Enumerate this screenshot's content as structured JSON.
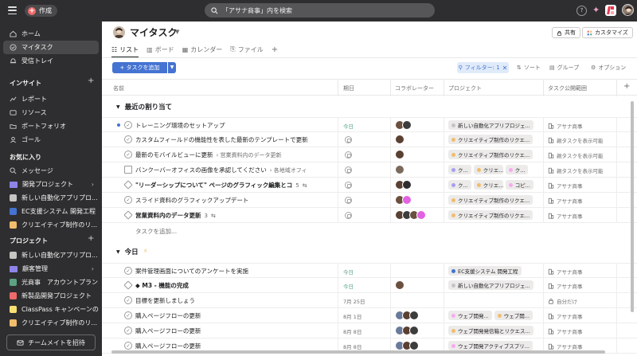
{
  "topbar": {
    "create_label": "作成",
    "search_text": "「アサナ商事」内を検索",
    "help_label": "?"
  },
  "sidebar": {
    "nav": [
      {
        "label": "ホーム",
        "icon": "home-icon"
      },
      {
        "label": "マイタスク",
        "icon": "check-circle-icon"
      },
      {
        "label": "受信トレイ",
        "icon": "bell-icon"
      }
    ],
    "insights_title": "インサイト",
    "insights": [
      {
        "label": "レポート",
        "icon": "chart-icon"
      },
      {
        "label": "リソース",
        "icon": "people-icon"
      },
      {
        "label": "ポートフォリオ",
        "icon": "folder-icon"
      },
      {
        "label": "ゴール",
        "icon": "person-icon"
      }
    ],
    "favorites_title": "お気に入り",
    "favorites": [
      {
        "label": "メッセージ",
        "type": "search",
        "color": ""
      },
      {
        "label": "開発プロジェクト",
        "type": "folder",
        "color": "#8d84e8"
      },
      {
        "label": "新しい自動化アプリプロ...",
        "type": "square",
        "color": "#c7c4c4"
      },
      {
        "label": "EC支援システム 開発工程",
        "type": "square",
        "color": "#4573d2"
      },
      {
        "label": "クリエイティブ制作のリ...",
        "type": "square",
        "color": "#f1bd6c"
      }
    ],
    "projects_title": "プロジェクト",
    "projects": [
      {
        "label": "新しい自動化アプリプロ...",
        "type": "square",
        "color": "#c7c4c4"
      },
      {
        "label": "顧客管理",
        "type": "folder",
        "color": "#8d84e8"
      },
      {
        "label": "光商事　アカウントプラン",
        "type": "square",
        "color": "#5da283"
      },
      {
        "label": "新製品開発プロジェクト",
        "type": "square",
        "color": "#f06a6a"
      },
      {
        "label": "ClassPass キャンペーンの...",
        "type": "square",
        "color": "#f8df72"
      },
      {
        "label": "クリエイティブ制作のリ...",
        "type": "square",
        "color": "#f1bd6c"
      }
    ],
    "invite_label": "チームメイトを招待"
  },
  "header": {
    "title": "マイタスク",
    "share_label": "共有",
    "customize_label": "カスタマイズ",
    "tabs": [
      {
        "label": "リスト",
        "icon": "list-icon"
      },
      {
        "label": "ボード",
        "icon": "board-icon"
      },
      {
        "label": "カレンダー",
        "icon": "calendar-icon"
      },
      {
        "label": "ファイル",
        "icon": "file-icon"
      }
    ],
    "add_tab": "+"
  },
  "toolbar": {
    "add_task_label": "+ タスクを追加",
    "filter_label": "フィルター: 1",
    "sort_label": "ソート",
    "group_label": "グループ",
    "options_label": "オプション"
  },
  "columns": {
    "name": "名前",
    "due": "期日",
    "collaborators": "コラボレーター",
    "project": "プロジェクト",
    "visibility": "タスク公開範囲"
  },
  "groups": [
    {
      "title": "最近の割り当て",
      "tasks": [
        {
          "name": "トレーニング環境のセットアップ",
          "sub": "",
          "badge": "",
          "date": "今日",
          "date_green": true,
          "check": "circle",
          "dot": true,
          "avatars": [
            "#6b4f3f",
            "#3d3d3d"
          ],
          "pills": [
            {
              "label": "新しい自動化アプリプロジェ...",
              "color": "#c7c4c4"
            }
          ],
          "visibility": "アサナ商事"
        },
        {
          "name": "カスタムフィールドの機能性を表した最新のテンプレートで更新",
          "sub": "",
          "badge": "",
          "date": "",
          "date_green": false,
          "check": "circle",
          "dot": false,
          "avatars": [
            "#5a4032"
          ],
          "pills": [
            {
              "label": "クリエイティブ制作のリクエ...",
              "color": "#f1bd6c"
            }
          ],
          "visibility": "親タスクを表示可能"
        },
        {
          "name": "最新のモバイルビューに更新",
          "sub": "› 営業資料内のデータ更新",
          "badge": "",
          "date": "",
          "date_green": false,
          "check": "circle",
          "dot": false,
          "avatars": [
            "#5a4032"
          ],
          "pills": [
            {
              "label": "クリエイティブ制作のリクエ...",
              "color": "#f1bd6c"
            }
          ],
          "visibility": "親タスクを表示可能"
        },
        {
          "name": "バンクーバーオフィスの画像を承認してください",
          "sub": "› 各地域オフィ",
          "badge": "",
          "date": "",
          "date_green": false,
          "check": "approval",
          "dot": false,
          "avatars": [
            "#7a6a5e"
          ],
          "pills": [
            {
              "label": "ク...",
              "color": "#a69ff3"
            },
            {
              "label": "クリエ...",
              "color": "#f1bd6c"
            },
            {
              "label": "ク...",
              "color": "#f9aaef"
            }
          ],
          "visibility": "親タスクを表示可能"
        },
        {
          "name": "\"リーダーシップについて\" ページのグラフィック編集とコ",
          "sub": "",
          "badge": "5",
          "date": "",
          "date_green": false,
          "check": "milestone",
          "dot": false,
          "avatars": [
            "#5a4032",
            "#2e2e30"
          ],
          "pills": [
            {
              "label": "ク...",
              "color": "#a69ff3"
            },
            {
              "label": "クリエ...",
              "color": "#f1bd6c"
            },
            {
              "label": "コピ...",
              "color": "#f9aaef"
            }
          ],
          "visibility": "アサナ商事"
        },
        {
          "name": "スライド資料のグラフィックアップデート",
          "sub": "",
          "badge": "",
          "date": "",
          "date_green": false,
          "check": "circle",
          "dot": false,
          "avatars": [
            "#6b4f3f",
            "#e362e3"
          ],
          "pills": [
            {
              "label": "クリエイティブ制作のリクエ...",
              "color": "#f1bd6c"
            }
          ],
          "visibility": "アサナ商事"
        },
        {
          "name": "営業資料内のデータ更新",
          "sub": "",
          "badge": "3",
          "date": "",
          "date_green": false,
          "check": "milestone",
          "dot": false,
          "avatars": [
            "#5a4032",
            "#3d3d3d",
            "#6b4f3f",
            "#e362e3"
          ],
          "pills": [
            {
              "label": "クリエイティブ制作のリクエ...",
              "color": "#f1bd6c"
            }
          ],
          "visibility": "アサナ商事"
        }
      ],
      "add_task": "タスクを追加..."
    },
    {
      "title": "今日",
      "tasks": [
        {
          "name": "案件管理画面についてのアンケートを実施",
          "sub": "",
          "badge": "",
          "date": "今日",
          "date_green": true,
          "check": "circle",
          "dot": false,
          "avatars": [],
          "pills": [
            {
              "label": "EC支援システム 開発工程",
              "color": "#4573d2"
            }
          ],
          "visibility": "アサナ商事"
        },
        {
          "name": "◆ M3 - 機能の完成",
          "sub": "",
          "badge": "",
          "date": "今日",
          "date_green": true,
          "check": "milestone",
          "dot": false,
          "avatars": [
            "#6b4f3f"
          ],
          "pills": [
            {
              "label": "新しい自動化アプリプロジェ...",
              "color": "#c7c4c4"
            }
          ],
          "visibility": "アサナ商事"
        },
        {
          "name": "目標を更新しましょう",
          "sub": "",
          "badge": "",
          "date": "7月 25日",
          "date_green": false,
          "check": "circle",
          "dot": false,
          "avatars": [],
          "pills": [],
          "visibility": "自分だけ"
        },
        {
          "name": "購入ページフローの更新",
          "sub": "",
          "badge": "",
          "date": "8月 1日",
          "date_green": false,
          "check": "circle",
          "dot": false,
          "avatars": [
            "#6a7a9a",
            "#5a4032",
            "#3d3d3d"
          ],
          "pills": [
            {
              "label": "ウェブ開発...",
              "color": "#f9aaef"
            },
            {
              "label": "ウェブ開...",
              "color": "#f1bd6c"
            }
          ],
          "visibility": "アサナ商事"
        },
        {
          "name": "購入ページフローの更新",
          "sub": "",
          "badge": "",
          "date": "8月 8日",
          "date_green": false,
          "check": "circle",
          "dot": false,
          "avatars": [
            "#6a7a9a",
            "#5a4032",
            "#3d3d3d"
          ],
          "pills": [
            {
              "label": "ウェブ開発発信箱とリクエス...",
              "color": "#f1bd6c"
            }
          ],
          "visibility": "アサナ商事"
        },
        {
          "name": "購入ページフローの更新",
          "sub": "",
          "badge": "",
          "date": "8月 8日",
          "date_green": false,
          "check": "circle",
          "dot": false,
          "avatars": [
            "#6a7a9a",
            "#5a4032",
            "#3d3d3d"
          ],
          "pills": [
            {
              "label": "ウェブ開発アクティブスプリ...",
              "color": "#f9aaef"
            }
          ],
          "visibility": "アサナ商事"
        }
      ]
    }
  ]
}
